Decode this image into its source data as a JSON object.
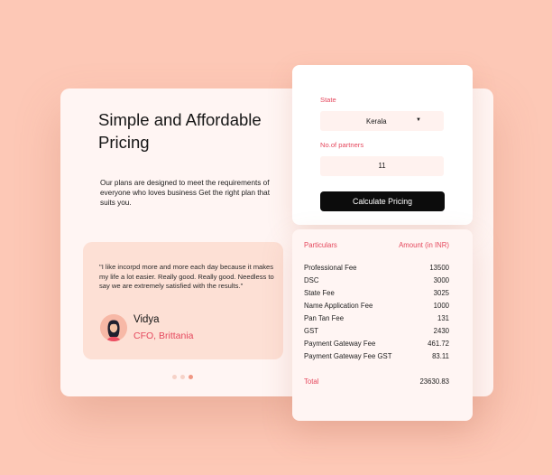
{
  "hero": {
    "title": "Simple and Affordable Pricing",
    "description": "Our plans are designed to meet the requirements of everyone who loves business Get the right plan that suits you."
  },
  "testimonial": {
    "quote": "\"I like incorpd more and more each day because it makes my life a lot easier. Really good. Really good. Needless to say we are extremely satisfied with the results.\"",
    "name": "Vidya",
    "role": "CFO, Brittania",
    "carousel": {
      "count": 3,
      "active_index": 2
    }
  },
  "form": {
    "state_label": "State",
    "state_value": "Kerala",
    "partners_label": "No.of partners",
    "partners_value": "11",
    "calculate_label": "Calculate Pricing"
  },
  "fees": {
    "col_particulars": "Particulars",
    "col_amount": "Amount (in INR)",
    "rows": [
      {
        "label": "Professional Fee",
        "amount": "13500"
      },
      {
        "label": "DSC",
        "amount": "3000"
      },
      {
        "label": "State Fee",
        "amount": "3025"
      },
      {
        "label": "Name Application Fee",
        "amount": "1000"
      },
      {
        "label": "Pan Tan Fee",
        "amount": "131"
      },
      {
        "label": "GST",
        "amount": "2430"
      },
      {
        "label": "Payment Gateway Fee",
        "amount": "461.72"
      },
      {
        "label": "Payment Gateway Fee GST",
        "amount": "83.11"
      }
    ],
    "total_label": "Total",
    "total_amount": "23630.83"
  },
  "colors": {
    "background": "#fdc8b6",
    "accent": "#e5485d",
    "button": "#0c0c0c",
    "active_dot": "#f09783"
  },
  "icons": [
    "caret-down-icon",
    "avatar-illustration"
  ]
}
